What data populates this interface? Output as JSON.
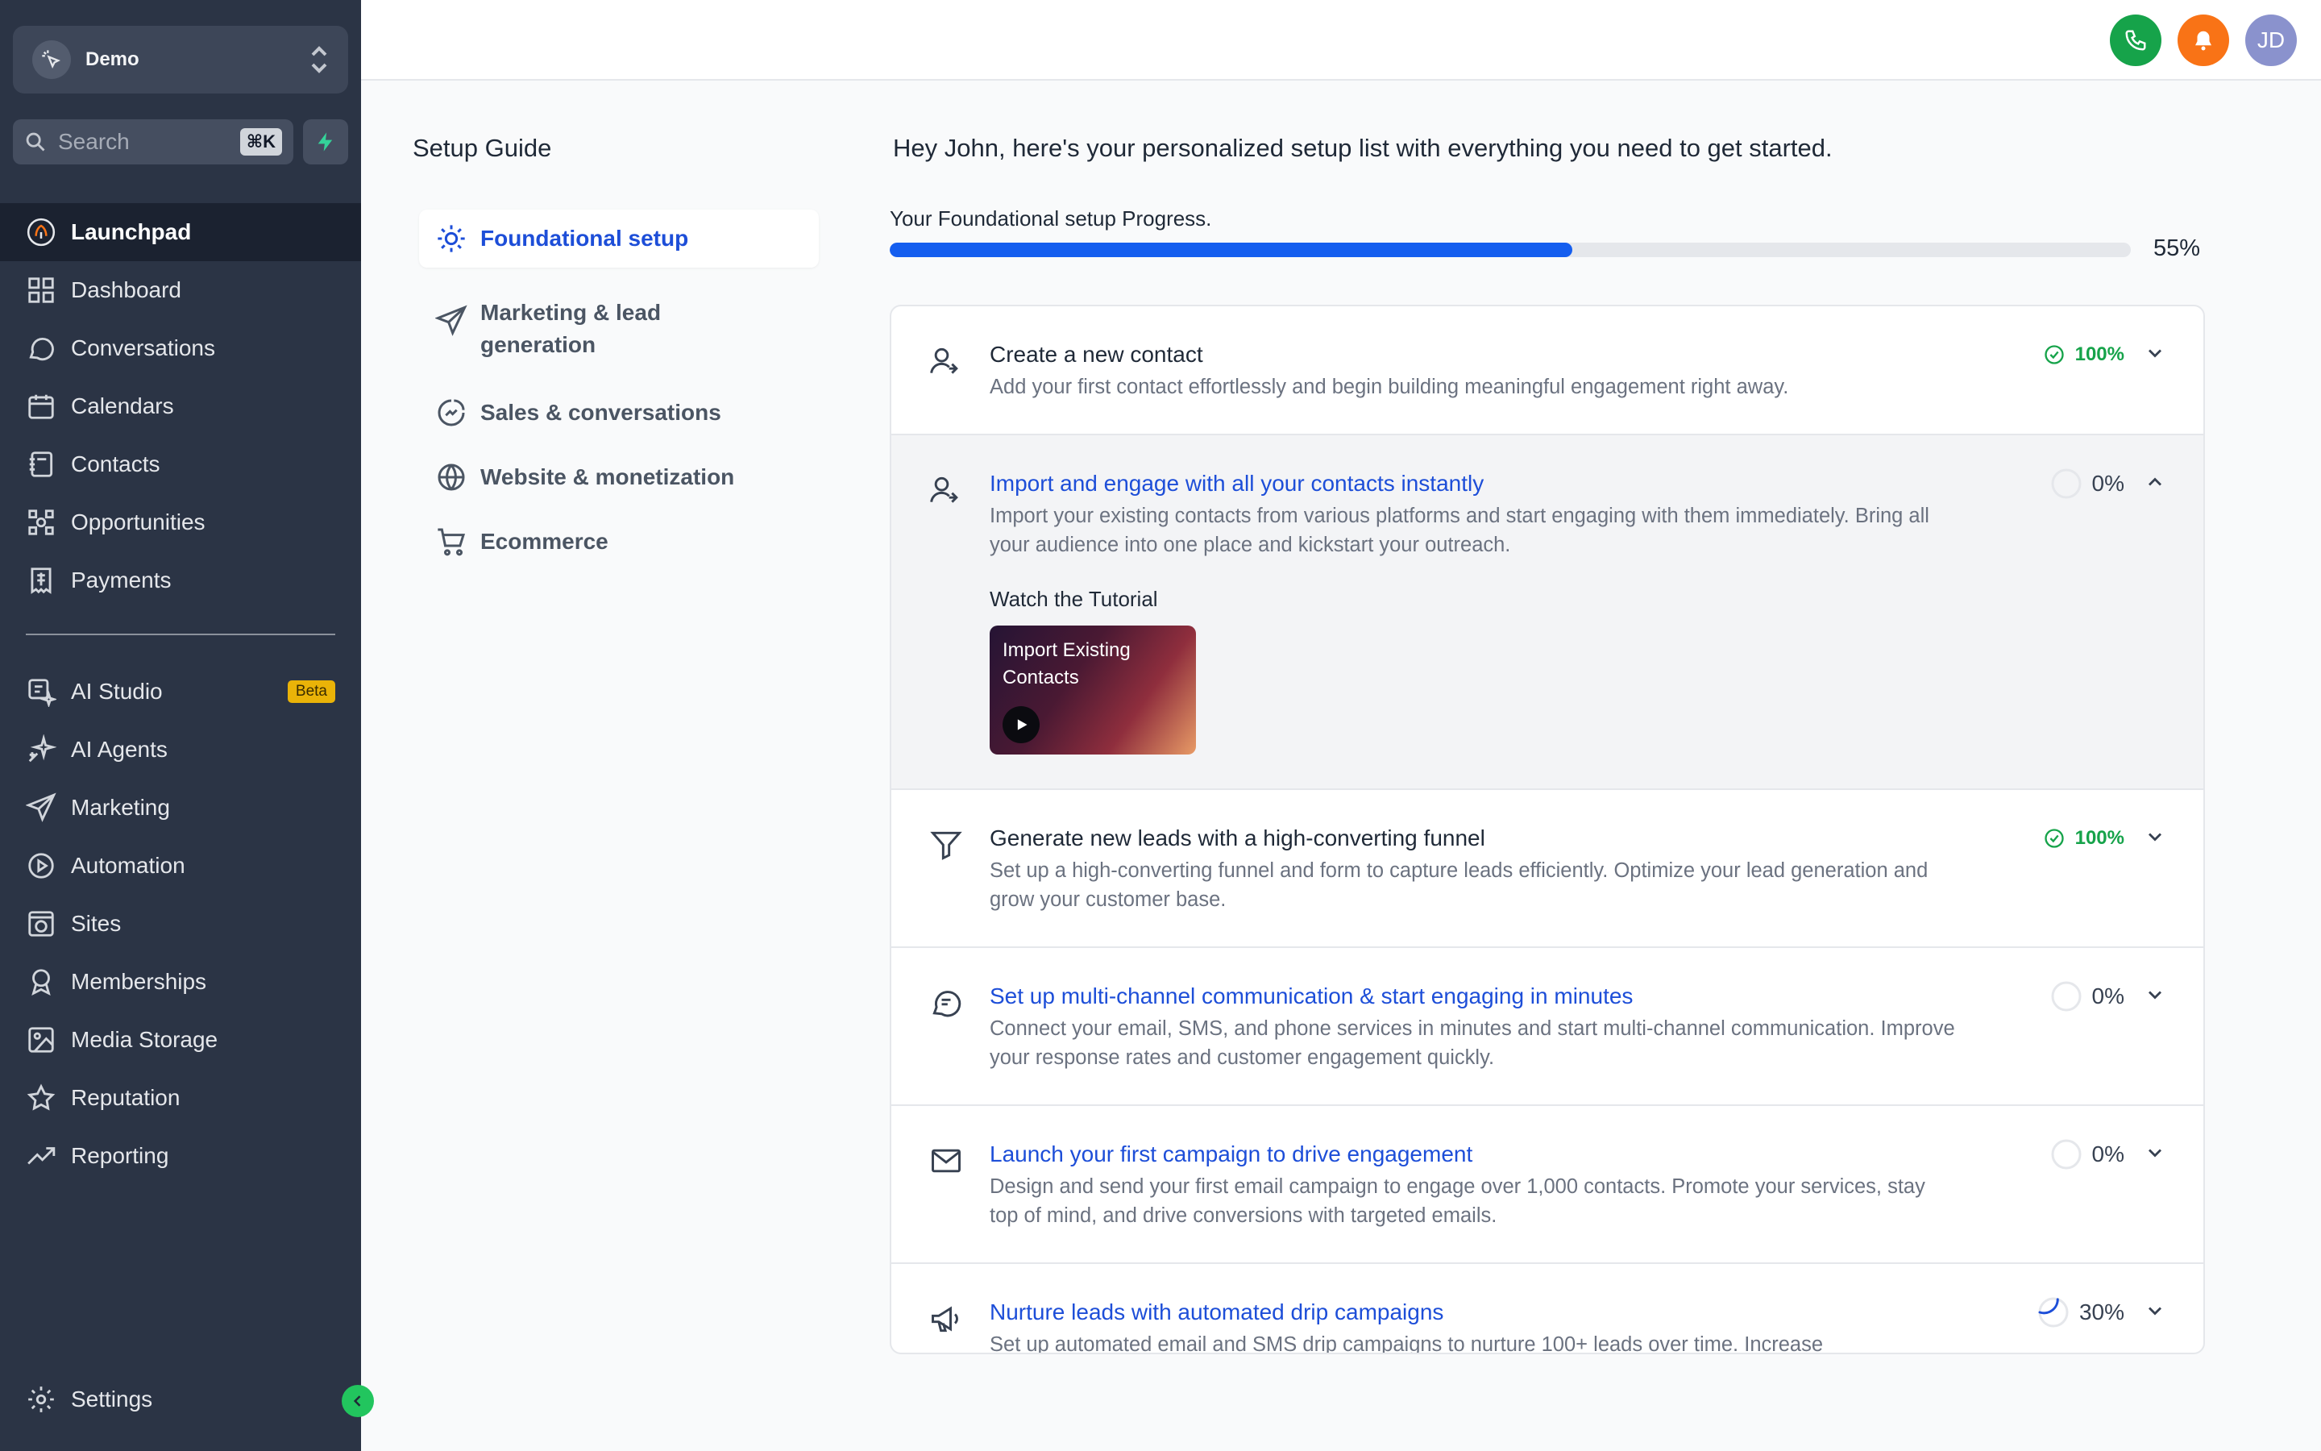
{
  "account": {
    "name": "Demo"
  },
  "search": {
    "placeholder": "Search",
    "shortcut": "⌘K"
  },
  "sidebar": {
    "items": [
      {
        "label": "Launchpad",
        "icon": "launchpad-icon"
      },
      {
        "label": "Dashboard",
        "icon": "dashboard-icon"
      },
      {
        "label": "Conversations",
        "icon": "chat-icon"
      },
      {
        "label": "Calendars",
        "icon": "calendar-icon"
      },
      {
        "label": "Contacts",
        "icon": "contacts-icon"
      },
      {
        "label": "Opportunities",
        "icon": "opportunities-icon"
      },
      {
        "label": "Payments",
        "icon": "payments-icon"
      }
    ],
    "items2": [
      {
        "label": "AI Studio",
        "icon": "ai-studio-icon",
        "badge": "Beta"
      },
      {
        "label": "AI Agents",
        "icon": "sparkles-icon"
      },
      {
        "label": "Marketing",
        "icon": "send-icon"
      },
      {
        "label": "Automation",
        "icon": "automation-icon"
      },
      {
        "label": "Sites",
        "icon": "globe-icon"
      },
      {
        "label": "Memberships",
        "icon": "badge-icon"
      },
      {
        "label": "Media Storage",
        "icon": "image-icon"
      },
      {
        "label": "Reputation",
        "icon": "star-icon"
      },
      {
        "label": "Reporting",
        "icon": "trend-icon"
      }
    ],
    "settings": "Settings"
  },
  "topbar": {
    "avatar": "JD",
    "colors": {
      "phone": "#16a34a",
      "bell": "#f97316",
      "avatar": "#8a92cd"
    }
  },
  "guide": {
    "title": "Setup Guide",
    "categories": [
      {
        "label": "Foundational setup"
      },
      {
        "label": "Marketing & lead generation"
      },
      {
        "label": "Sales & conversations"
      },
      {
        "label": "Website & monetization"
      },
      {
        "label": "Ecommerce"
      }
    ]
  },
  "main": {
    "greeting": "Hey John, here's your personalized setup list with everything you need to get started.",
    "progress_label": "Your Foundational setup Progress.",
    "progress": 55,
    "progress_text": "55%",
    "tasks": [
      {
        "title": "Create a new contact",
        "desc": "Add your first contact effortlessly and begin building meaningful engagement right away.",
        "pct": "100%"
      },
      {
        "title": "Import and engage with all your contacts instantly",
        "desc": "Import your existing contacts from various platforms and start engaging with them immediately. Bring all your audience into one place and kickstart your outreach.",
        "pct": "0%",
        "tutorial_label": "Watch the Tutorial",
        "video_title": "Import Existing Contacts"
      },
      {
        "title": "Generate new leads with a high-converting funnel",
        "desc": "Set up a high-converting funnel and form to capture leads efficiently. Optimize your lead generation and grow your customer base.",
        "pct": "100%"
      },
      {
        "title": "Set up multi-channel communication & start engaging in minutes",
        "desc": "Connect your email, SMS, and phone services in minutes and start multi-channel communication. Improve your response rates and customer engagement quickly.",
        "pct": "0%"
      },
      {
        "title": "Launch your first campaign to drive engagement",
        "desc": "Design and send your first email campaign to engage over 1,000 contacts. Promote your services, stay top of mind, and drive conversions with targeted emails.",
        "pct": "0%"
      },
      {
        "title": "Nurture leads with automated drip campaigns",
        "desc": "Set up automated email and SMS drip campaigns to nurture 100+ leads over time. Increase",
        "pct": "30%"
      }
    ]
  }
}
